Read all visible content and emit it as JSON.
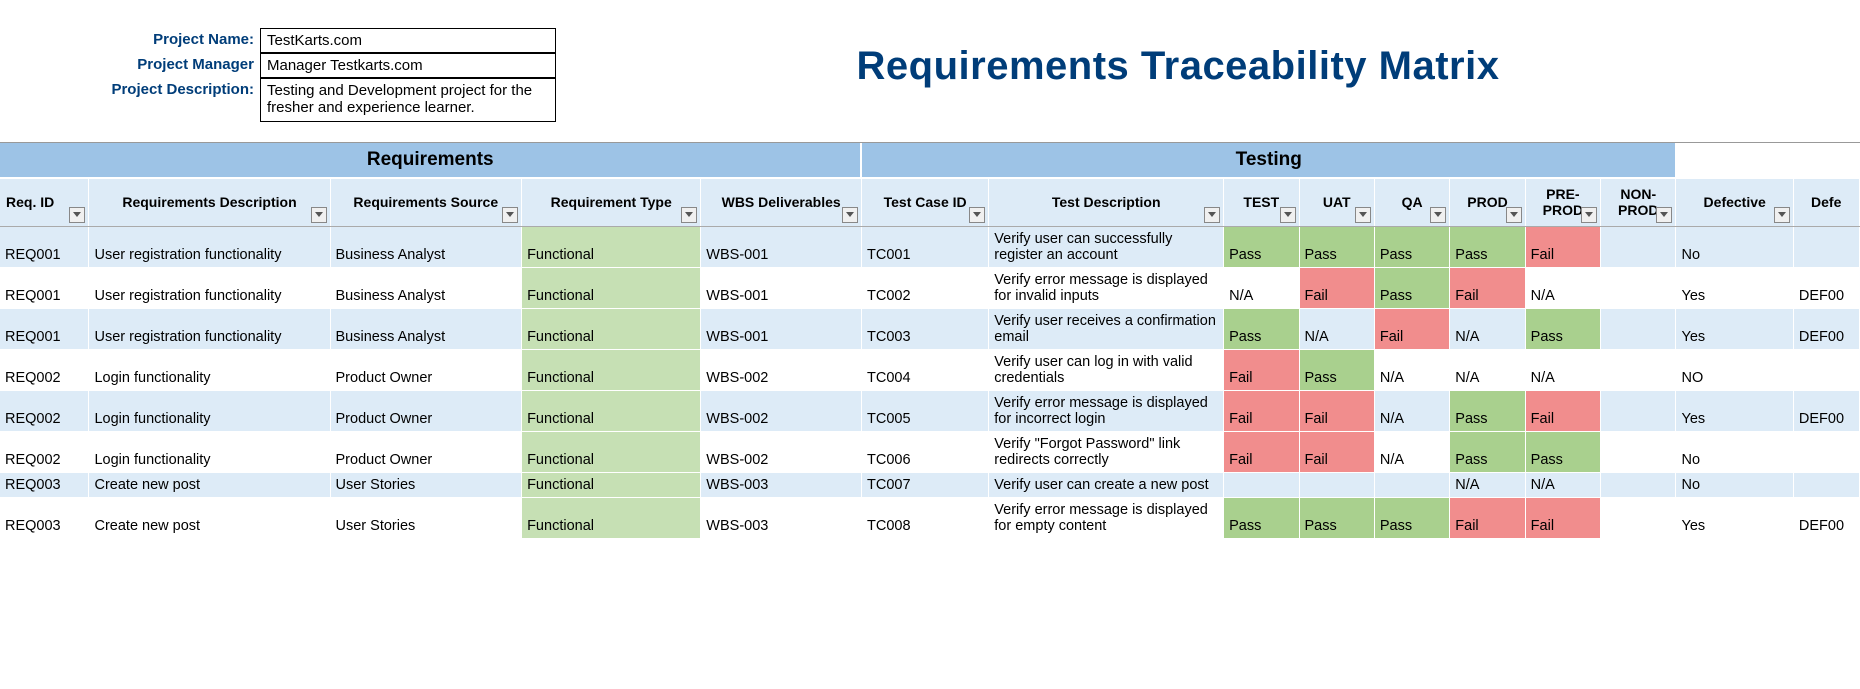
{
  "project": {
    "labels": {
      "name": "Project Name:",
      "manager": "Project Manager",
      "description": "Project Description:"
    },
    "name": "TestKarts.com",
    "manager": "Manager Testkarts.com",
    "description": "Testing and Development project for the fresher and experience learner."
  },
  "title": "Requirements Traceability Matrix",
  "groups": {
    "req": "Requirements",
    "test": "Testing"
  },
  "columns": {
    "reqid": "Req. ID",
    "reqdesc": "Requirements Description",
    "reqsrc": "Requirements Source",
    "reqtype": "Requirement Type",
    "wbs": "WBS Deliverables",
    "tcid": "Test Case ID",
    "tdesc": "Test Description",
    "envs": [
      "TEST",
      "UAT",
      "QA",
      "PROD",
      "PRE-PROD",
      "NON-PROD"
    ],
    "defective": "Defective",
    "defectid": "Defe"
  },
  "rows": [
    {
      "reqid": "REQ001",
      "reqdesc": "User registration functionality",
      "reqsrc": "Business Analyst",
      "reqtype": "Functional",
      "wbs": "WBS-001",
      "tcid": "TC001",
      "tdesc": "Verify user can successfully register an account",
      "env": [
        "Pass",
        "Pass",
        "Pass",
        "Pass",
        "Fail",
        ""
      ],
      "defective": "No",
      "defid": ""
    },
    {
      "reqid": "REQ001",
      "reqdesc": "User registration functionality",
      "reqsrc": "Business Analyst",
      "reqtype": "Functional",
      "wbs": "WBS-001",
      "tcid": "TC002",
      "tdesc": "Verify error message is displayed for invalid inputs",
      "env": [
        "N/A",
        "Fail",
        "Pass",
        "Fail",
        "N/A",
        ""
      ],
      "defective": "Yes",
      "defid": "DEF00"
    },
    {
      "reqid": "REQ001",
      "reqdesc": "User registration functionality",
      "reqsrc": "Business Analyst",
      "reqtype": "Functional",
      "wbs": "WBS-001",
      "tcid": "TC003",
      "tdesc": "Verify user receives a confirmation email",
      "env": [
        "Pass",
        "N/A",
        "Fail",
        "N/A",
        "Pass",
        ""
      ],
      "defective": "Yes",
      "defid": "DEF00"
    },
    {
      "reqid": "REQ002",
      "reqdesc": "Login functionality",
      "reqsrc": "Product Owner",
      "reqtype": "Functional",
      "wbs": "WBS-002",
      "tcid": "TC004",
      "tdesc": "Verify user can log in with valid credentials",
      "env": [
        "Fail",
        "Pass",
        "N/A",
        "N/A",
        "N/A",
        ""
      ],
      "defective": "NO",
      "defid": ""
    },
    {
      "reqid": "REQ002",
      "reqdesc": "Login functionality",
      "reqsrc": "Product Owner",
      "reqtype": "Functional",
      "wbs": "WBS-002",
      "tcid": "TC005",
      "tdesc": "Verify error message is displayed for incorrect login",
      "env": [
        "Fail",
        "Fail",
        "N/A",
        "Pass",
        "Fail",
        ""
      ],
      "defective": "Yes",
      "defid": "DEF00"
    },
    {
      "reqid": "REQ002",
      "reqdesc": "Login functionality",
      "reqsrc": "Product Owner",
      "reqtype": "Functional",
      "wbs": "WBS-002",
      "tcid": "TC006",
      "tdesc": "Verify \"Forgot Password\" link redirects correctly",
      "env": [
        "Fail",
        "Fail",
        "N/A",
        "Pass",
        "Pass",
        ""
      ],
      "defective": "No",
      "defid": ""
    },
    {
      "reqid": "REQ003",
      "reqdesc": "Create new post",
      "reqsrc": "User Stories",
      "reqtype": "Functional",
      "wbs": "WBS-003",
      "tcid": "TC007",
      "tdesc": "Verify user can create a new post",
      "env": [
        "",
        "",
        "",
        "N/A",
        "N/A",
        ""
      ],
      "defective": "No",
      "defid": ""
    },
    {
      "reqid": "REQ003",
      "reqdesc": "Create new post",
      "reqsrc": "User Stories",
      "reqtype": "Functional",
      "wbs": "WBS-003",
      "tcid": "TC008",
      "tdesc": "Verify error message is displayed for empty content",
      "env": [
        "Pass",
        "Pass",
        "Pass",
        "Fail",
        "Fail",
        ""
      ],
      "defective": "Yes",
      "defid": "DEF00"
    }
  ]
}
